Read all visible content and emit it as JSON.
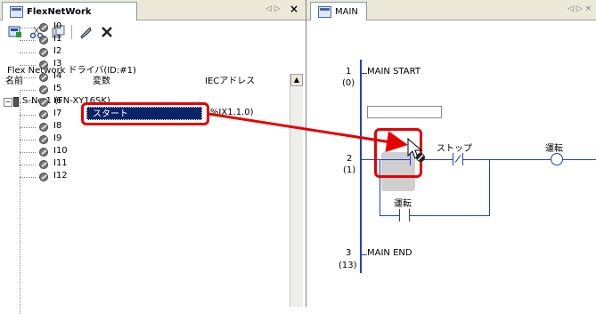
{
  "left_panel": {
    "tab_title": "FlexNetWork",
    "tab_nav": "◁ ▷",
    "tab_close": "×",
    "driver_label": "Flex Network ドライバ(ID:#1)",
    "headers": {
      "name": "名前",
      "variable": "変数",
      "iec": "IECアドレス"
    },
    "station": "S-No.1 (FN-XY16SK)",
    "rows": [
      {
        "label": "I0",
        "variable": "スタート",
        "iec": "(%IX1.1.0)"
      },
      {
        "label": "I1"
      },
      {
        "label": "I2"
      },
      {
        "label": "I3"
      },
      {
        "label": "I4"
      },
      {
        "label": "I5"
      },
      {
        "label": "I6"
      },
      {
        "label": "I7"
      },
      {
        "label": "I8"
      },
      {
        "label": "I9"
      },
      {
        "label": "I10"
      },
      {
        "label": "I11"
      },
      {
        "label": "I12"
      }
    ]
  },
  "right_panel": {
    "tab_title": "MAIN",
    "tab_nav": "◁ ▷ ×",
    "rungs": [
      {
        "num": "1",
        "step": "(0)",
        "label": "MAIN START"
      },
      {
        "num": "2",
        "step": "(1)",
        "contact_stop": "ストップ",
        "coil": "運転",
        "branch": "運転"
      },
      {
        "num": "3",
        "step": "(13)",
        "label": "MAIN END"
      }
    ]
  },
  "colors": {
    "accent_red": "#e60000",
    "ladder_blue": "#2040c0",
    "selection": "#0a246a"
  }
}
